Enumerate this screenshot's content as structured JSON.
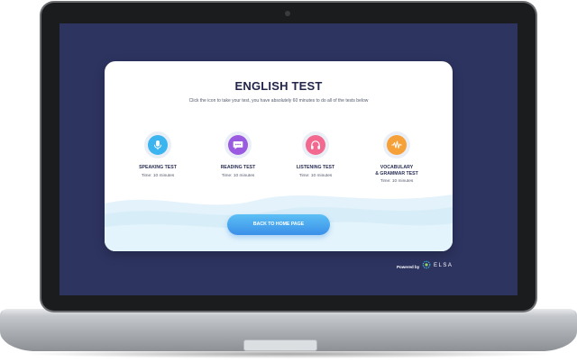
{
  "card": {
    "title": "ENGLISH TEST",
    "subtitle": "Click the icon to take your test, you have absolutely 60 minutes to do all of the tests below"
  },
  "tests": [
    {
      "name": "SPEAKING TEST",
      "time": "Time: 10 minutes",
      "icon": "microphone-icon",
      "color": "#3cb4f0"
    },
    {
      "name": "READING TEST",
      "time": "Time: 10 minutes",
      "icon": "chat-bubble-icon",
      "color": "#9a5be0"
    },
    {
      "name": "LISTENING TEST",
      "time": "Time: 10 minutes",
      "icon": "headphones-icon",
      "color": "#f2688e"
    },
    {
      "name_line1": "VOCABULARY",
      "name_line2": "& GRAMMAR TEST",
      "time": "Time: 10 minutes",
      "icon": "soundwave-icon",
      "color": "#f6a03a"
    }
  ],
  "button": {
    "label": "BACK TO HOME PAGE"
  },
  "footer": {
    "powered_by": "Powered by",
    "brand": "ELSA"
  }
}
